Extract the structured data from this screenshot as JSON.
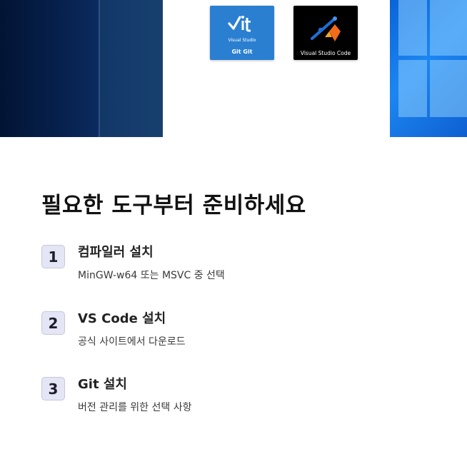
{
  "banner": {
    "git_logo": {
      "top_text": "Visual Studio",
      "bottom_text": "Git Git"
    },
    "vscode_logo": {
      "text": "Visual Studio Code"
    }
  },
  "heading": "필요한 도구부터 준비하세요",
  "steps": [
    {
      "number": "1",
      "title": "컴파일러 설치",
      "description": "MinGW-w64 또는 MSVC 중 선택"
    },
    {
      "number": "2",
      "title": "VS Code 설치",
      "description": "공식 사이트에서 다운로드"
    },
    {
      "number": "3",
      "title": "Git 설치",
      "description": "버전 관리를 위한 선택 사항"
    }
  ]
}
